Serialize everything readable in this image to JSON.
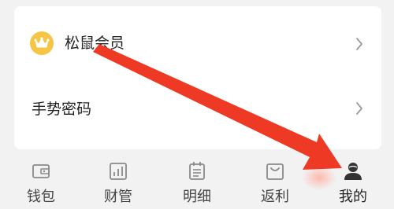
{
  "menu": {
    "vip_label": "松鼠会员",
    "gesture_label": "手势密码"
  },
  "tabs": [
    {
      "label": "钱包",
      "icon": "wallet-icon"
    },
    {
      "label": "财管",
      "icon": "chart-icon"
    },
    {
      "label": "明细",
      "icon": "calendar-icon"
    },
    {
      "label": "返利",
      "icon": "bag-icon"
    },
    {
      "label": "我的",
      "icon": "user-icon"
    }
  ],
  "colors": {
    "accent_crown": "#f6c545",
    "annotation_arrow": "#ee3a25",
    "icon_gray": "#8a8a8a",
    "active_icon": "#333333"
  }
}
